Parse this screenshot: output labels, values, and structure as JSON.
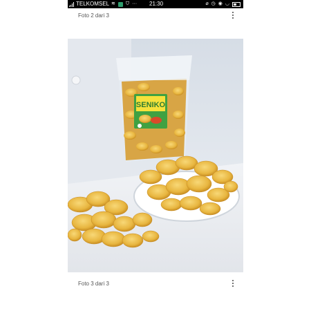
{
  "status_bar": {
    "carrier": "TELKOMSEL",
    "time": "21:30",
    "more_indicator": "···",
    "icons": [
      "signal-icon",
      "wifi-icon",
      "app-badge-icon",
      "shield-icon",
      "alarm-icon",
      "clock-icon",
      "eye-icon",
      "battery-icon"
    ]
  },
  "photos": [
    {
      "caption": "Foto 2 dari 3"
    },
    {
      "caption": "Foto 3 dari 3"
    }
  ],
  "product": {
    "package_label": "SENIKO"
  },
  "colors": {
    "status_bar_bg": "#000000",
    "caption_text": "#555555",
    "chip_yellow": "#e8b640",
    "label_green": "#3fa142"
  }
}
